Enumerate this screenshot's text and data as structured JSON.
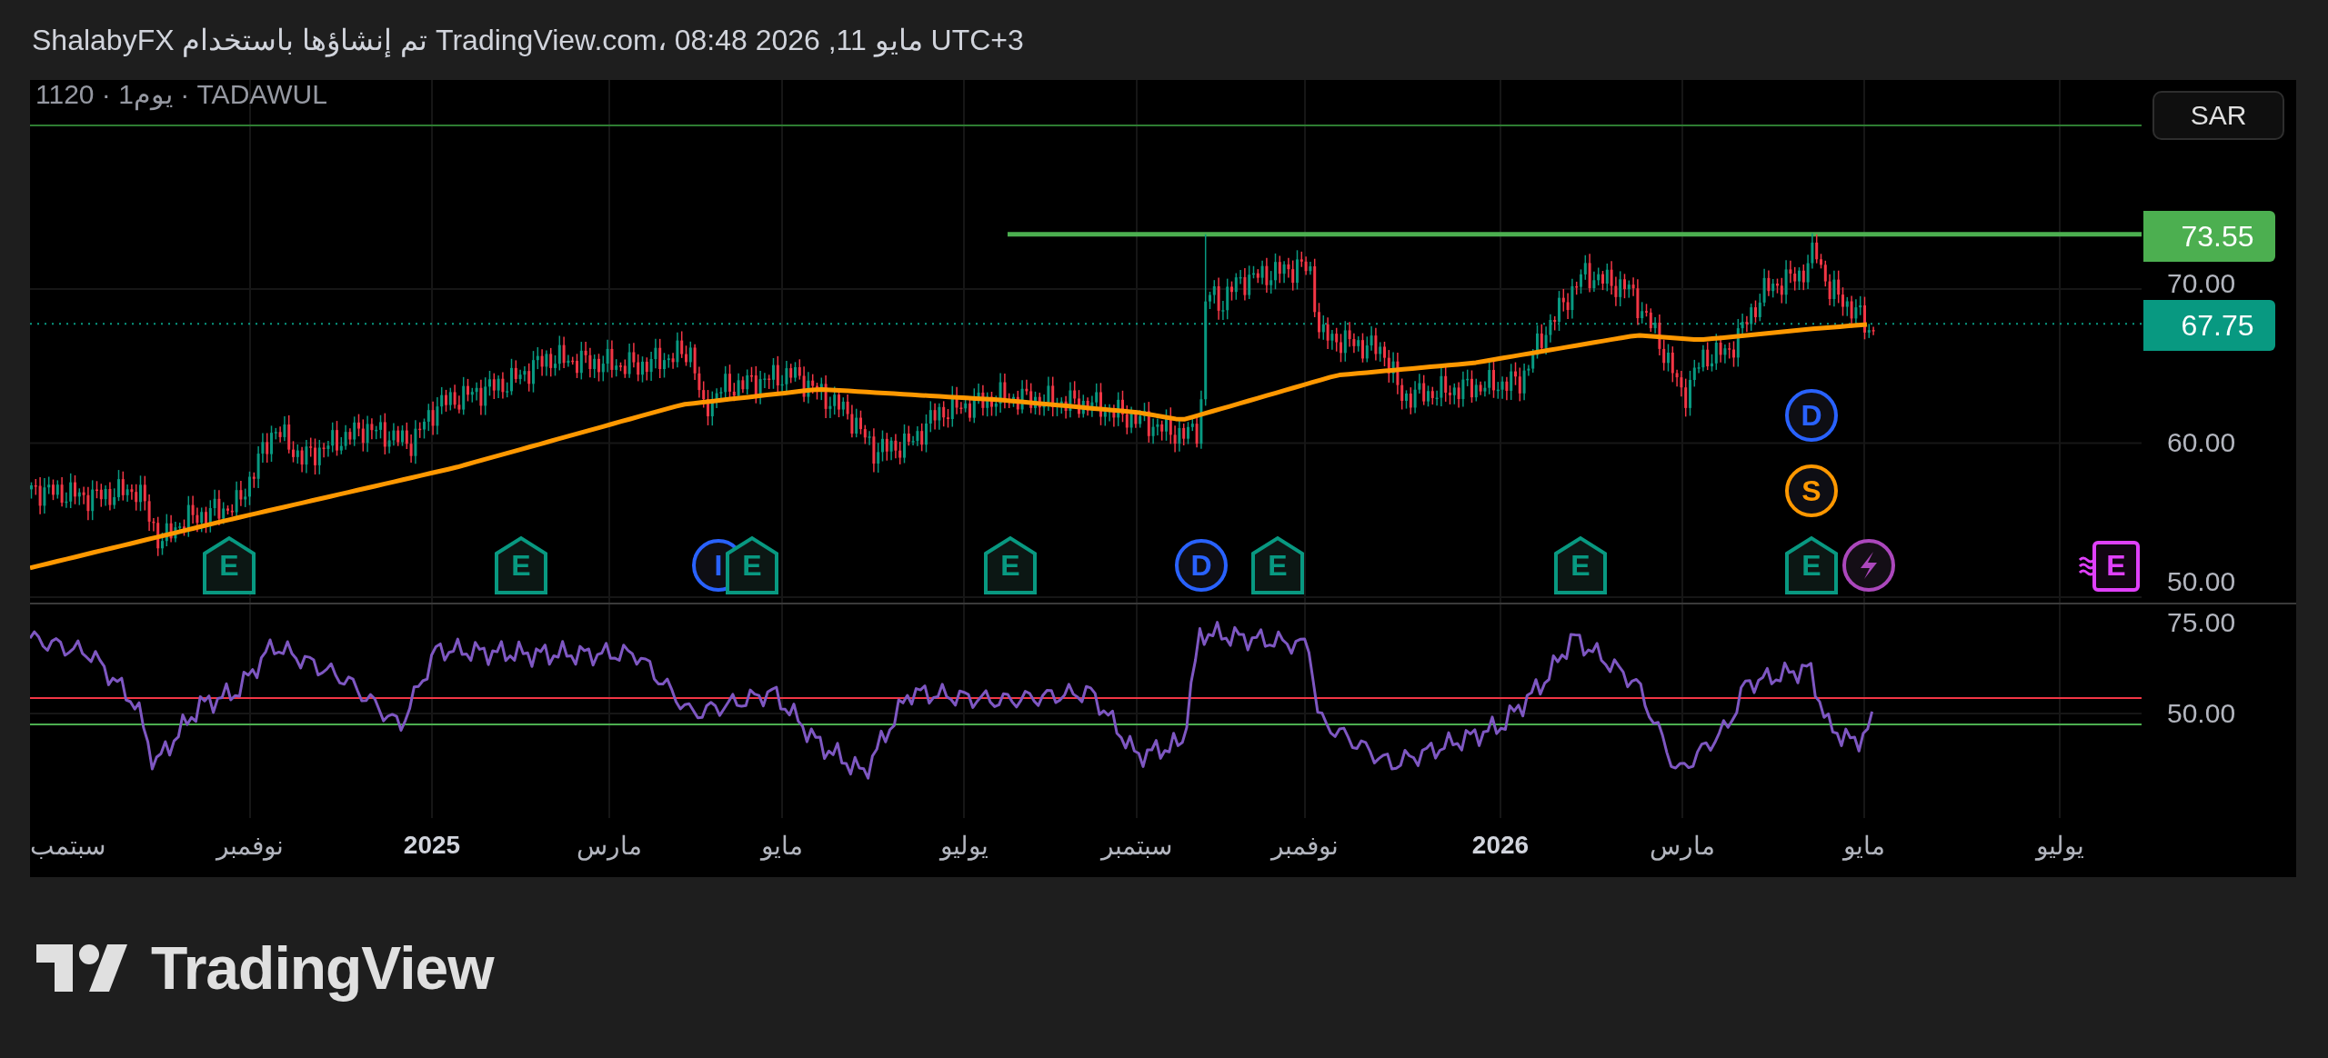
{
  "header": {
    "text": "UTC+3 مايو 11, 2026 08:48 ،TradingView.com تم إنشاؤها باستخدام ShalabyFX"
  },
  "chart": {
    "legend": "1120 · 1يوم · TADAWUL",
    "currency_button": "SAR",
    "price_axis": [
      "70.00",
      "60.00",
      "50.00"
    ],
    "price_tags": [
      {
        "text": "73.55",
        "color": "#4caf50"
      },
      {
        "text": "67.75",
        "color": "#089981"
      }
    ],
    "rsi_axis": [
      "75.00",
      "50.00"
    ],
    "time_axis": [
      {
        "label": "يوليو",
        "kind": "month"
      },
      {
        "label": "مايو",
        "kind": "month"
      },
      {
        "label": "مارس",
        "kind": "month"
      },
      {
        "label": "2026",
        "kind": "year"
      },
      {
        "label": "نوفمبر",
        "kind": "month"
      },
      {
        "label": "سبتمبر",
        "kind": "month"
      },
      {
        "label": "يوليو",
        "kind": "month"
      },
      {
        "label": "مايو",
        "kind": "month"
      },
      {
        "label": "مارس",
        "kind": "month"
      },
      {
        "label": "2025",
        "kind": "year"
      },
      {
        "label": "نوفمبر",
        "kind": "month"
      },
      {
        "label": "سبتمب",
        "kind": "month"
      }
    ],
    "markers": [
      {
        "kind": "upcoming",
        "letter": "E",
        "color": "#e040fb"
      },
      {
        "kind": "flash",
        "color": "#ab47bc"
      },
      {
        "kind": "dividend",
        "letter": "D",
        "color": "#2962ff"
      },
      {
        "kind": "split",
        "letter": "S",
        "color": "#ff9800"
      },
      {
        "kind": "earnings",
        "letter": "E",
        "color": "#089981"
      },
      {
        "kind": "earnings",
        "letter": "E",
        "color": "#089981"
      },
      {
        "kind": "earnings",
        "letter": "E",
        "color": "#089981"
      },
      {
        "kind": "dividend",
        "letter": "D",
        "color": "#2962ff"
      },
      {
        "kind": "earnings",
        "letter": "E",
        "color": "#089981"
      },
      {
        "kind": "earnings",
        "letter": "E",
        "color": "#089981"
      },
      {
        "kind": "dividend",
        "letter": "I",
        "color": "#2962ff"
      },
      {
        "kind": "earnings",
        "letter": "E",
        "color": "#089981"
      },
      {
        "kind": "earnings",
        "letter": "E",
        "color": "#089981"
      }
    ]
  },
  "logo": {
    "text": "TradingView"
  }
}
